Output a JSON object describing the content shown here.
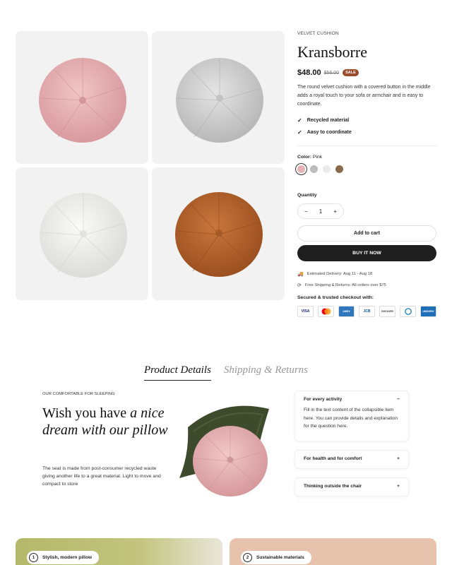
{
  "product": {
    "eyebrow": "VELVET CUSHION",
    "title": "Kransborre",
    "price": "$48.00",
    "old_price": "$56.00",
    "sale_badge": "SALE",
    "description": "The round velvet cushion with a covered button in the middle adds a royal touch to your sofa or armchair and is easy to coordinate.",
    "features": [
      "Recycled material",
      "Aasy to coordinate"
    ],
    "color_label": "Color:",
    "color_value": "Pink",
    "swatches": [
      {
        "name": "Pink",
        "hex": "#e6b4b6"
      },
      {
        "name": "Grey",
        "hex": "#bcbcbc"
      },
      {
        "name": "White",
        "hex": "#ebebeb"
      },
      {
        "name": "Brown",
        "hex": "#8a6a4c"
      }
    ],
    "quantity_label": "Quantity",
    "quantity": "1",
    "qty_minus": "−",
    "qty_plus": "+",
    "add_to_cart": "Add to cart",
    "buy_now": "BUY IT NOW",
    "delivery": "Estimated Delivery: Aug 11 - Aug 18",
    "shipping": "Free Shipping & Returns: All orders over $75",
    "secured": "Secured & trusted checkout with:",
    "payment_cards": [
      "VISA",
      "MC",
      "AMEX",
      "JCB",
      "DISCOVER",
      "DINERS",
      "UNIONPAY"
    ]
  },
  "colors": {
    "pink": "#e8b3b6",
    "grey": "#cfcfcf",
    "white": "#efefee",
    "brown": "#b5622d",
    "sale": "#9a4b2c",
    "button_dark": "#1f1f1f"
  },
  "tabs": [
    "Product Details",
    "Shipping & Returns"
  ],
  "details": {
    "eyebrow": "OUR COMFORTABLE FOR SLEEPING",
    "headline_1": "Wish you have ",
    "headline_2": "a nice dream with our pillow",
    "body": "The seat is made from post-consumer recycled waste giving another life to a great material. Light to move and compact to store"
  },
  "accordion": [
    {
      "title": "For every activity",
      "toggle": "−",
      "body": "Fill in the text content of the collapsible item here. You can provide details and explanation for the question here."
    },
    {
      "title": "For health and for comfort",
      "toggle": "+"
    },
    {
      "title": "Thinking outside the chair",
      "toggle": "+"
    }
  ],
  "highlights": [
    {
      "num": "1",
      "label": "Stylish, modern pillow"
    },
    {
      "num": "2",
      "label": "Sustainable materials"
    }
  ]
}
